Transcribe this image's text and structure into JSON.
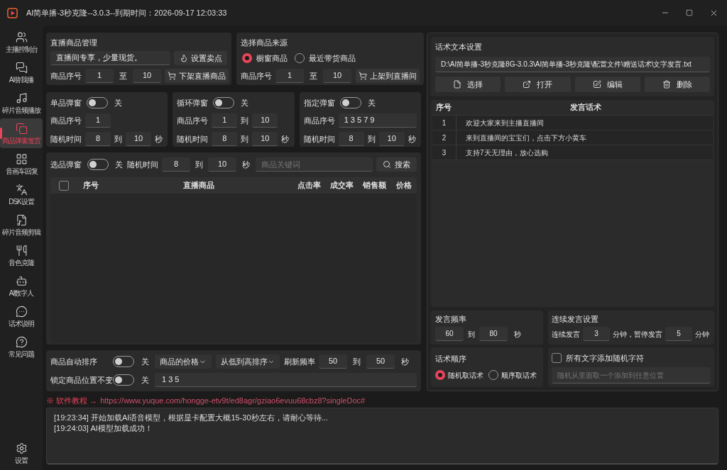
{
  "window": {
    "title": "AI简单播-3秒克隆--3.0.3--到期时间：2026-09-17 12:03:33"
  },
  "sidebar": {
    "items": [
      {
        "label": "主播控制台",
        "selected": false
      },
      {
        "label": "AI替我播",
        "selected": false
      },
      {
        "label": "碎片音频播放",
        "selected": false
      },
      {
        "label": "商品弹窗发言",
        "selected": true
      },
      {
        "label": "音画车回复",
        "selected": false
      },
      {
        "label": "DSK设置",
        "selected": false
      },
      {
        "label": "碎片音频剪辑",
        "selected": false
      },
      {
        "label": "音色克隆",
        "selected": false
      },
      {
        "label": "AI数字人",
        "selected": false
      },
      {
        "label": "话术说明",
        "selected": false
      },
      {
        "label": "常见问题",
        "selected": false
      }
    ],
    "settings": {
      "label": "设置",
      "selected": false
    }
  },
  "product_management": {
    "title": "直播商品管理",
    "selling_point": "直播间专享，少量现货。",
    "set_button": "设置卖点",
    "range_label": "商品序号",
    "from": "1",
    "to_label": "至",
    "to": "10",
    "remove_button": "下架直播商品"
  },
  "product_source": {
    "title": "选择商品来源",
    "options": [
      {
        "label": "橱窗商品",
        "selected": true
      },
      {
        "label": "最近带货商品",
        "selected": false
      }
    ],
    "range_label": "商品序号",
    "from": "1",
    "to_label": "至",
    "to": "10",
    "add_button": "上架到直播间"
  },
  "popups": [
    {
      "title": "单品弹窗",
      "on": false,
      "state_label": "关",
      "rows": [
        {
          "label": "商品序号",
          "parts": [
            {
              "kind": "field",
              "value": "1"
            }
          ]
        },
        {
          "label": "随机时间",
          "parts": [
            {
              "kind": "field",
              "value": "8"
            },
            {
              "kind": "text",
              "value": "到"
            },
            {
              "kind": "field",
              "value": "10"
            },
            {
              "kind": "text",
              "value": "秒"
            }
          ]
        }
      ]
    },
    {
      "title": "循环弹窗",
      "on": false,
      "state_label": "关",
      "rows": [
        {
          "label": "商品序号",
          "parts": [
            {
              "kind": "field",
              "value": "1"
            },
            {
              "kind": "text",
              "value": "到"
            },
            {
              "kind": "field",
              "value": "10"
            }
          ]
        },
        {
          "label": "随机时间",
          "parts": [
            {
              "kind": "field",
              "value": "8"
            },
            {
              "kind": "text",
              "value": "到"
            },
            {
              "kind": "field",
              "value": "10"
            },
            {
              "kind": "text",
              "value": "秒"
            }
          ]
        }
      ]
    },
    {
      "title": "指定弹窗",
      "on": false,
      "state_label": "关",
      "rows": [
        {
          "label": "商品序号",
          "parts": [
            {
              "kind": "long_field",
              "value": "1 3 5 7 9"
            }
          ]
        },
        {
          "label": "随机时间",
          "parts": [
            {
              "kind": "field",
              "value": "8"
            },
            {
              "kind": "text",
              "value": "到"
            },
            {
              "kind": "field",
              "value": "10"
            },
            {
              "kind": "text",
              "value": "秒"
            }
          ]
        }
      ]
    }
  ],
  "selection_popup": {
    "title": "选品弹窗",
    "on": false,
    "state_label": "关",
    "time_label": "随机时间",
    "from": "8",
    "sep": "到",
    "to": "10",
    "unit": "秒",
    "search": {
      "placeholder": "商品关键词"
    },
    "search_button": "搜索"
  },
  "product_table": {
    "select_all": {
      "checked": false
    },
    "columns": [
      "序号",
      "直播商品",
      "点击率",
      "成交率",
      "销售额",
      "价格"
    ]
  },
  "sorting": {
    "auto_sort": {
      "label": "商品自动排序",
      "on": false,
      "state_label": "关"
    },
    "sort_field": "商品的价格",
    "sort_order": "从低到高排序",
    "refresh_label": "刷新频率",
    "from": "50",
    "sep": "到",
    "to": "50",
    "unit": "秒",
    "lock": {
      "label": "锁定商品位置不变",
      "on": false,
      "state_label": "关",
      "value": "1 3 5"
    }
  },
  "tutorial_link": {
    "prefix": "※ 软件教程 →",
    "url": "https://www.yuque.com/hongge-etv9t/ed8agr/gziao6evuu68cbz8?singleDoc#"
  },
  "log": {
    "lines": [
      "[19:23:34] 开始加载AI语音模型，根据显卡配置大概15-30秒左右，请耐心等待...",
      "[19:24:03] AI模型加载成功！"
    ]
  },
  "script_settings": {
    "title": "话术文本设置",
    "path": "D:\\AI简单播-3秒克隆8G-3.0.3\\AI简单播-3秒克隆\\配置文件\\赠送话术\\文字发言.txt",
    "buttons": [
      {
        "kind": "select",
        "label": "选择"
      },
      {
        "kind": "open",
        "label": "打开"
      },
      {
        "kind": "edit",
        "label": "编辑"
      },
      {
        "kind": "delete",
        "label": "删除"
      }
    ]
  },
  "script_table": {
    "columns": [
      "序号",
      "发言话术"
    ],
    "rows": [
      [
        "1",
        "欢迎大家来到主播直播间"
      ],
      [
        "2",
        "来到直播间的宝宝们，点击下方小黄车"
      ],
      [
        "3",
        "支持7天无理由，放心选购"
      ]
    ]
  },
  "speech_frequency": {
    "title": "发言频率",
    "from": "60",
    "sep": "到",
    "to": "80",
    "unit": "秒"
  },
  "continuous_speech": {
    "title": "连续发言设置",
    "speak_label": "连续发言",
    "speak": "3",
    "middle_label": "分钟，暂停发言",
    "pause": "5",
    "unit": "分钟"
  },
  "script_order": {
    "title": "话术顺序",
    "options": [
      {
        "label": "随机取话术",
        "selected": true
      },
      {
        "label": "顺序取话术",
        "selected": false
      }
    ]
  },
  "random_chars": {
    "label": "所有文字添加随机字符",
    "checked": false,
    "placeholder": "随机从里面取一个添加到任意位置"
  }
}
